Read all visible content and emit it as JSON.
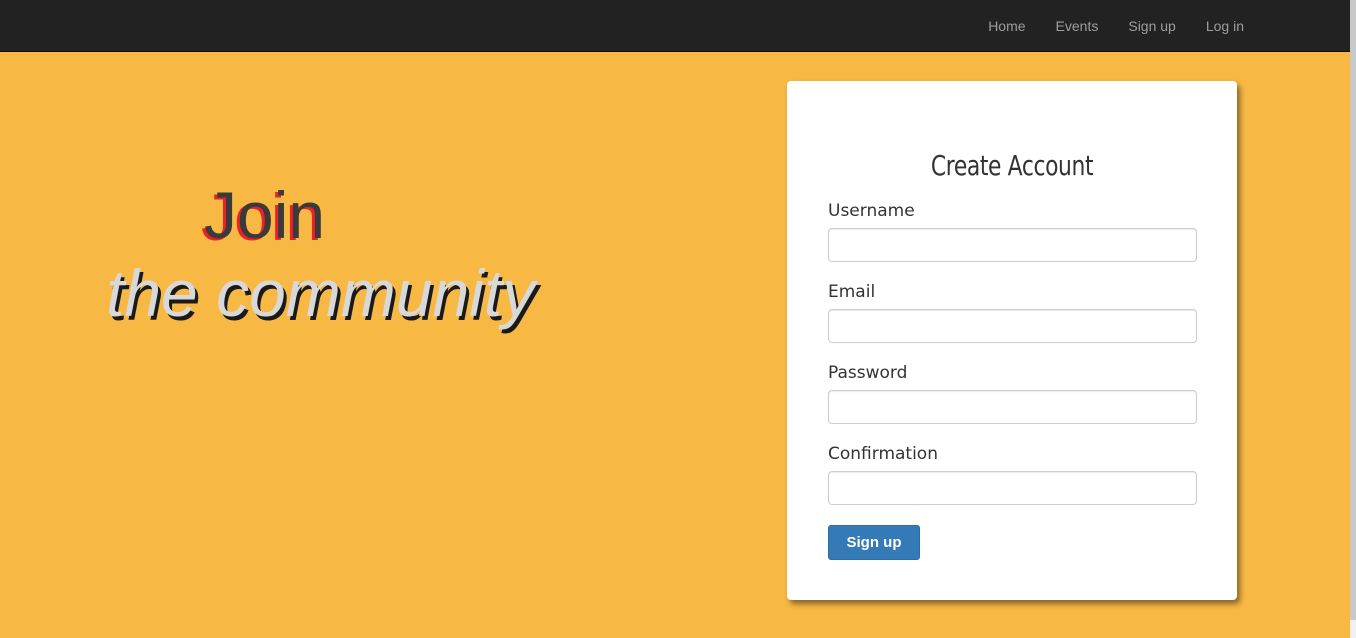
{
  "nav": {
    "items": [
      {
        "label": "Home"
      },
      {
        "label": "Events"
      },
      {
        "label": "Sign up"
      },
      {
        "label": "Log in"
      }
    ]
  },
  "hero": {
    "line1": "Join",
    "line2": "the community"
  },
  "form": {
    "title": "Create Account",
    "fields": [
      {
        "label": "Username",
        "value": "",
        "type": "text"
      },
      {
        "label": "Email",
        "value": "",
        "type": "email"
      },
      {
        "label": "Password",
        "value": "",
        "type": "password"
      },
      {
        "label": "Confirmation",
        "value": "",
        "type": "password"
      }
    ],
    "submit_label": "Sign up"
  },
  "colors": {
    "background": "#f7b844",
    "navbar": "#222222",
    "nav_text": "#9d9d9d",
    "primary_button": "#337ab7",
    "join_shadow": "#e8222a"
  }
}
